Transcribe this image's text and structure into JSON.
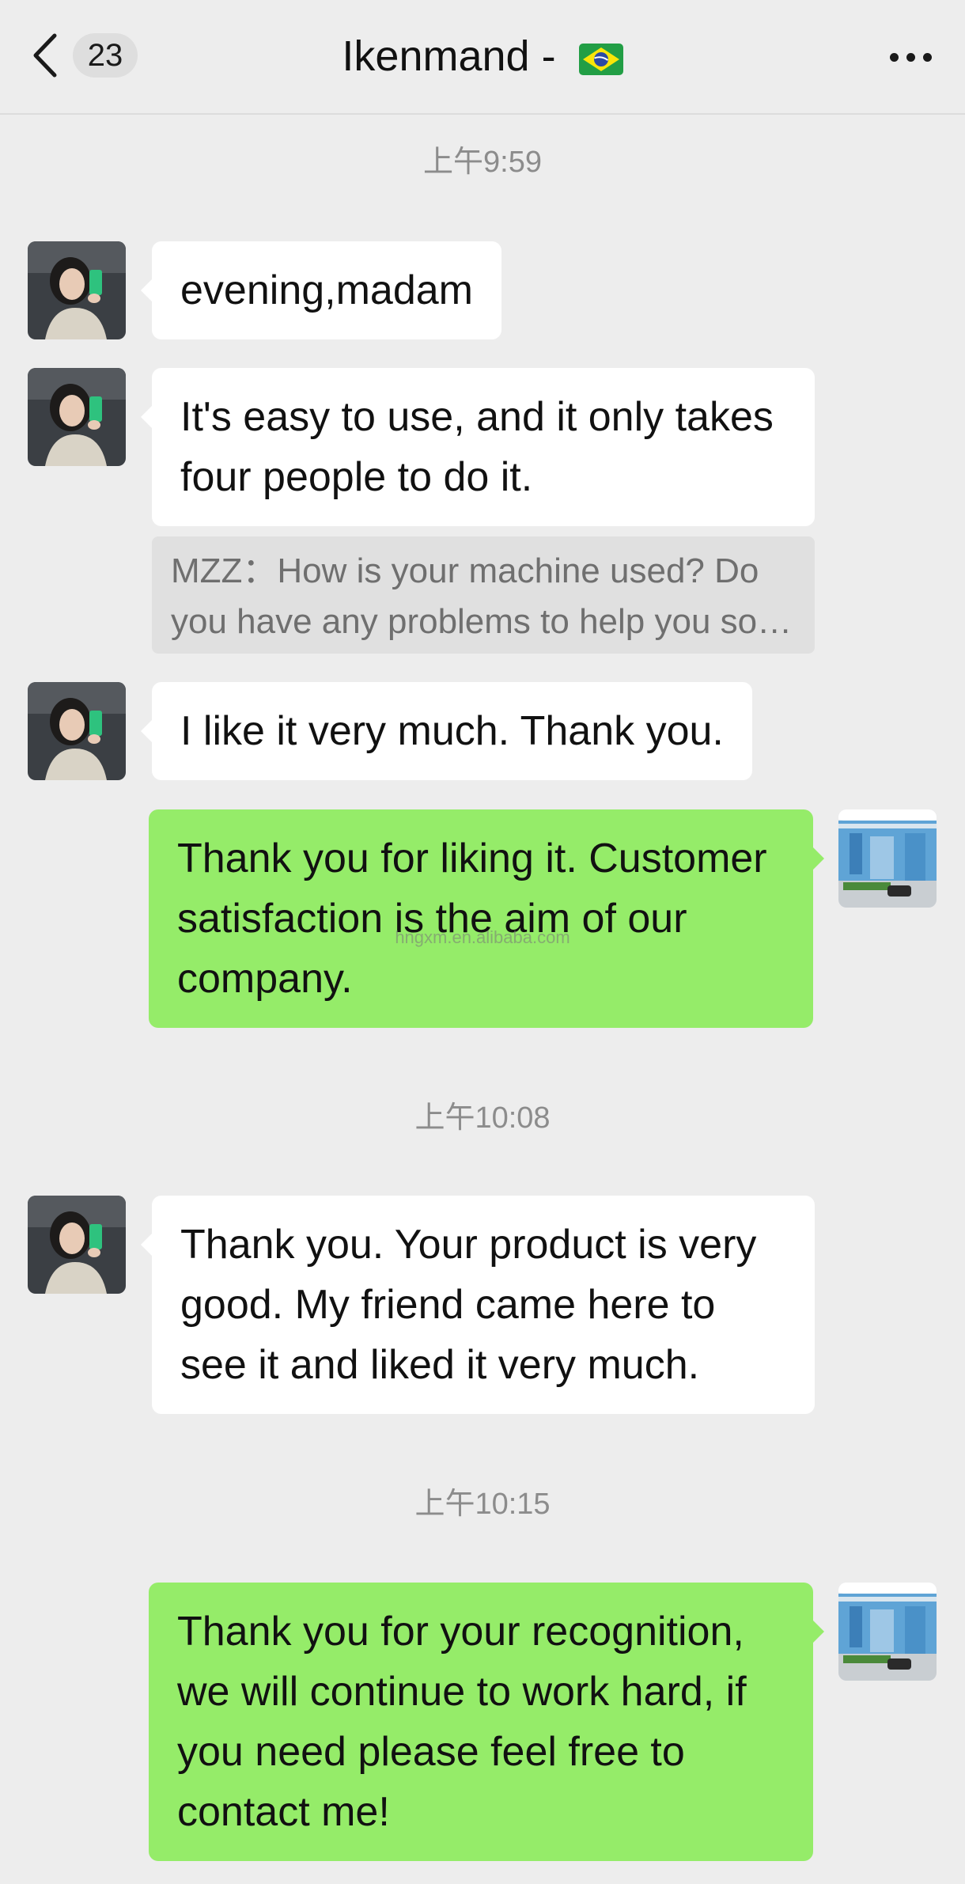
{
  "header": {
    "unread_count": "23",
    "title": "Ikenmand -",
    "flag": "brazil-flag"
  },
  "messages": [
    {
      "type": "timestamp",
      "text": "上午9:59"
    },
    {
      "type": "incoming",
      "text": "evening,madam"
    },
    {
      "type": "incoming",
      "text": "It's easy to use, and it only takes four people to do it."
    },
    {
      "type": "quote",
      "sender": "MZZ",
      "text": "How is your machine used? Do you have any problems to help you so…"
    },
    {
      "type": "incoming",
      "text": "I like it very much. Thank you."
    },
    {
      "type": "outgoing",
      "text": "Thank you for liking it. Customer satisfaction is the aim of our company."
    },
    {
      "type": "timestamp",
      "text": "上午10:08"
    },
    {
      "type": "incoming",
      "text": "Thank you. Your product is very good. My friend came here to see it and liked it very much."
    },
    {
      "type": "timestamp",
      "text": "上午10:15"
    },
    {
      "type": "outgoing",
      "text": "Thank you for your recognition, we will continue to work hard, if you need please feel free to contact me!"
    }
  ],
  "quote_display": {
    "line1": "MZZ：How is your machine used? Do",
    "line2": "you have any problems to help you so…"
  },
  "watermark": "hngxm.en.alibaba.com",
  "colors": {
    "background": "#ededed",
    "incoming_bubble": "#ffffff",
    "outgoing_bubble": "#95ec69",
    "timestamp": "#8c8c8c"
  }
}
